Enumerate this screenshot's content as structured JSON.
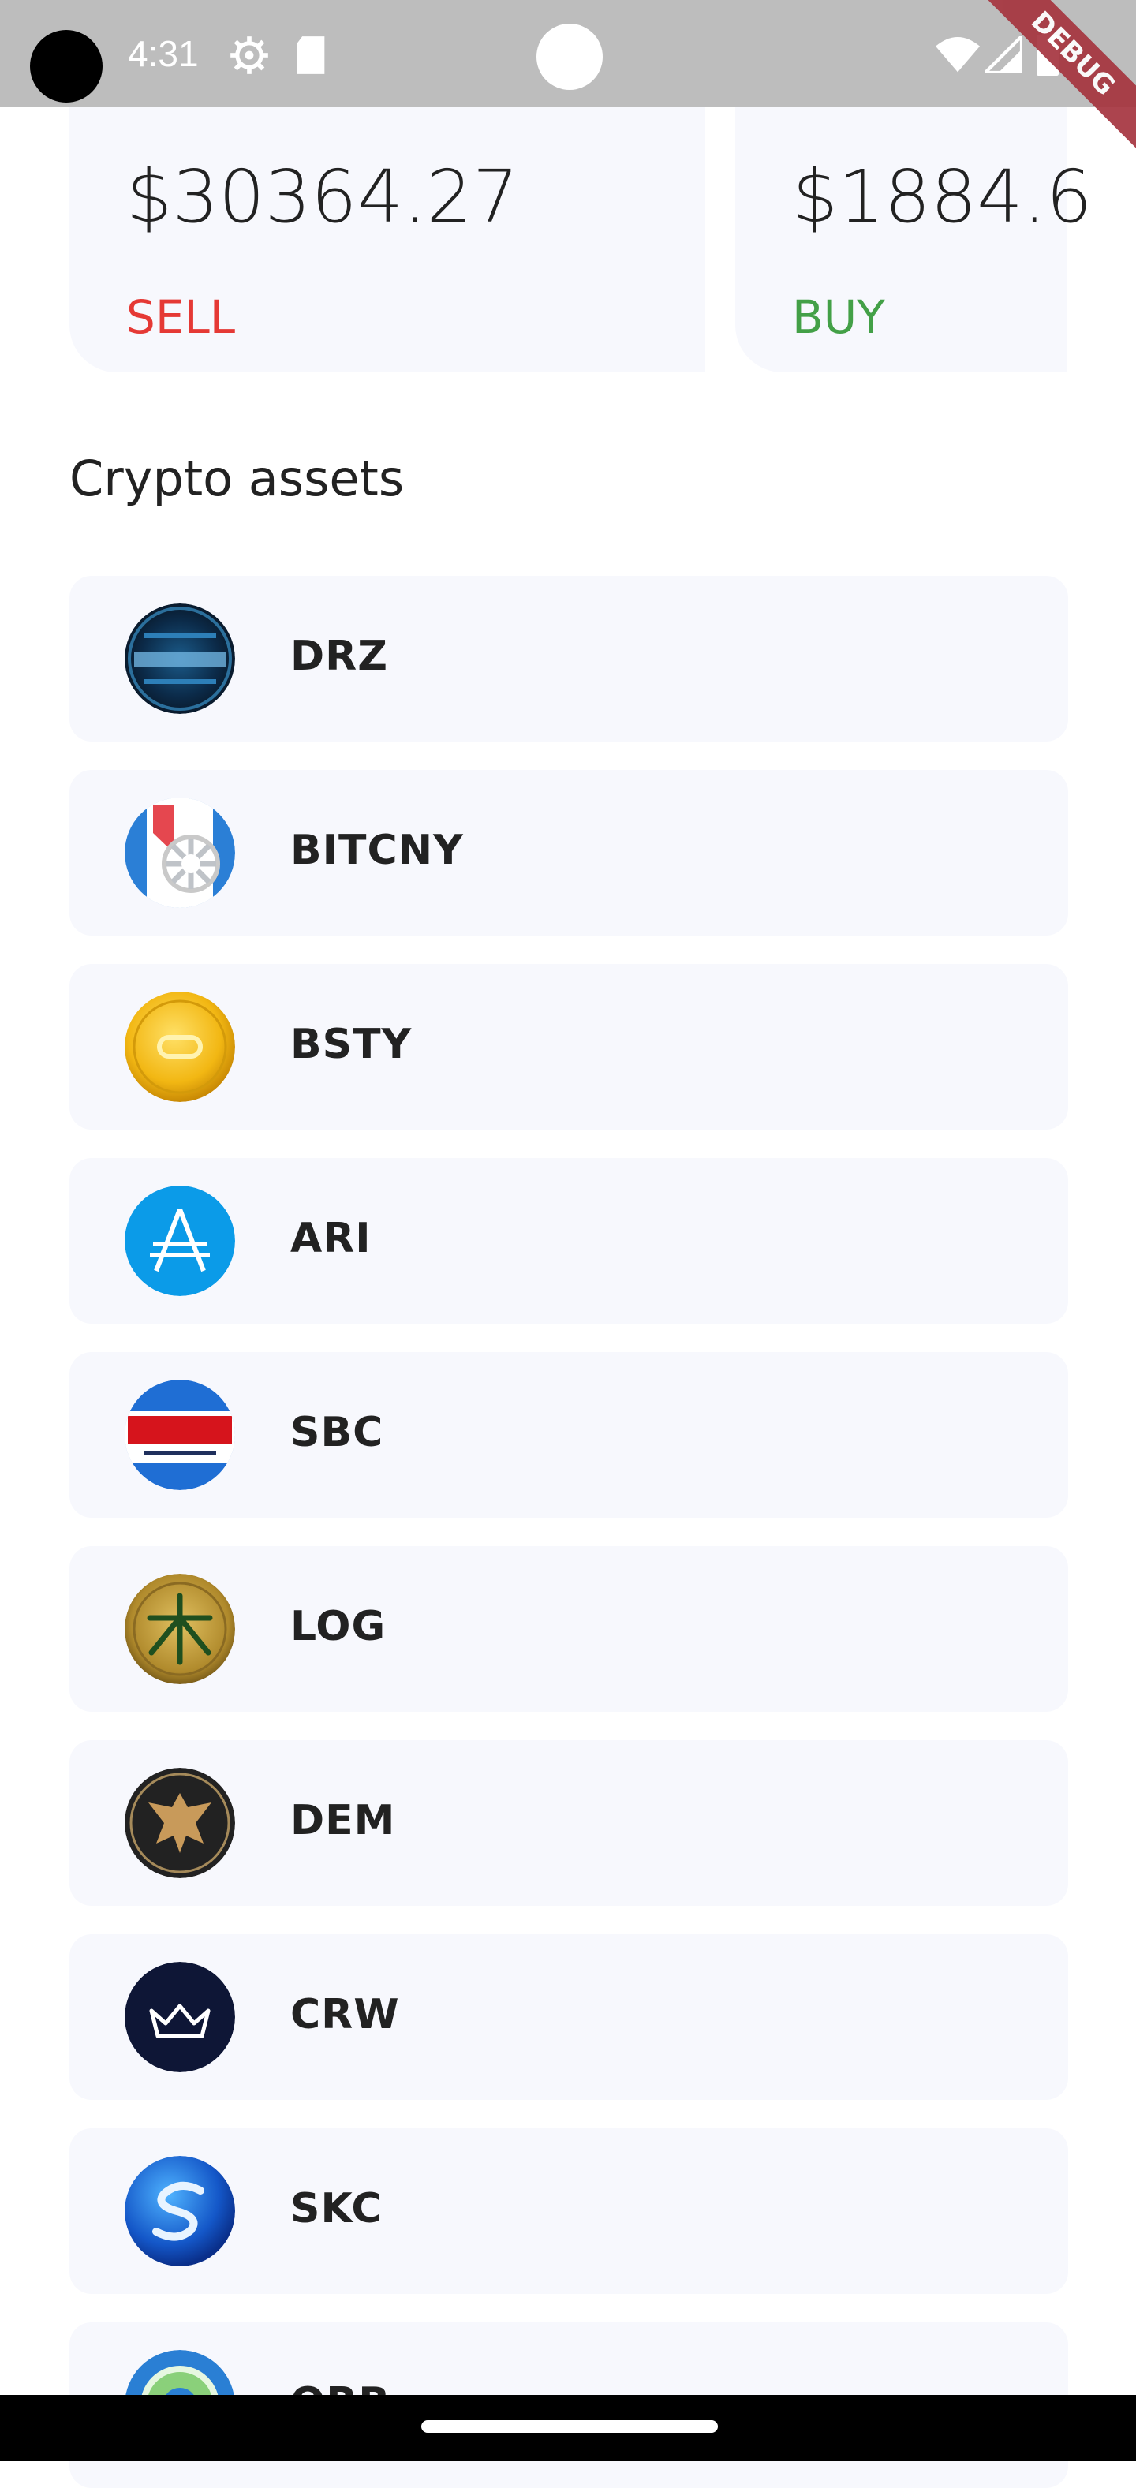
{
  "status_bar": {
    "time": "4:31",
    "debug_label": "DEBUG"
  },
  "price_cards": [
    {
      "price": "$30364.27",
      "action": "SELL"
    },
    {
      "price": "$1884.6",
      "action": "BUY"
    }
  ],
  "section_title": "Crypto assets",
  "assets": [
    {
      "symbol": "DRZ",
      "icon": "droidz-coin-icon"
    },
    {
      "symbol": "BITCNY",
      "icon": "bitcny-coin-icon"
    },
    {
      "symbol": "BSTY",
      "icon": "bsty-gold-coin-icon"
    },
    {
      "symbol": "ARI",
      "icon": "ari-coin-icon"
    },
    {
      "symbol": "SBC",
      "icon": "sbc-coin-icon"
    },
    {
      "symbol": "LOG",
      "icon": "log-coin-icon"
    },
    {
      "symbol": "DEM",
      "icon": "dem-eagle-coin-icon"
    },
    {
      "symbol": "CRW",
      "icon": "crw-crown-coin-icon"
    },
    {
      "symbol": "SKC",
      "icon": "skc-coin-icon"
    },
    {
      "symbol": "ORB",
      "icon": "orb-coin-icon"
    }
  ],
  "colors": {
    "sell": "#e53935",
    "buy": "#43a047",
    "card_bg": "#f7f8fd"
  }
}
